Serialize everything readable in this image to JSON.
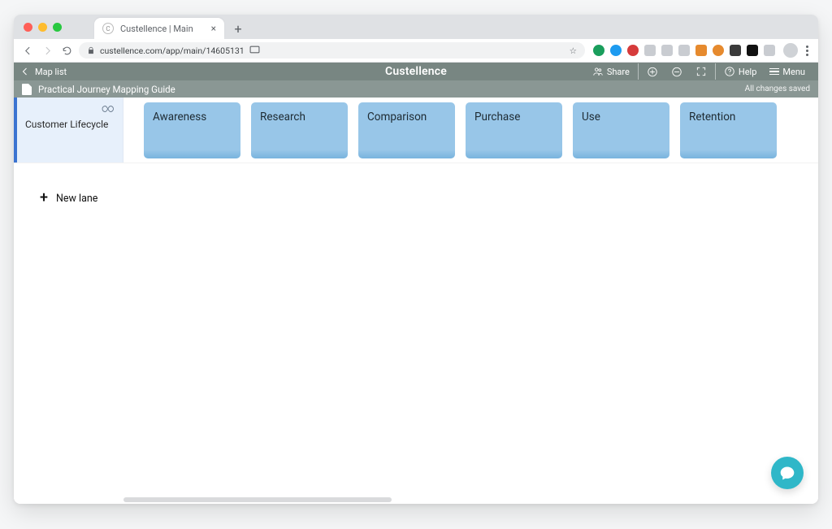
{
  "browser": {
    "tab_title": "Custellence | Main",
    "url": "custellence.com/app/main/14605131",
    "new_tab_label": "+"
  },
  "toolbar": {
    "back_label": "Map list",
    "brand": "Custellence",
    "share_label": "Share",
    "help_label": "Help",
    "menu_label": "Menu"
  },
  "document": {
    "title": "Practical Journey Mapping Guide",
    "status": "All changes saved"
  },
  "lane": {
    "title": "Customer Lifecycle",
    "stages": [
      {
        "label": "Awareness"
      },
      {
        "label": "Research"
      },
      {
        "label": "Comparison"
      },
      {
        "label": "Purchase"
      },
      {
        "label": "Use"
      },
      {
        "label": "Retention"
      }
    ]
  },
  "actions": {
    "new_lane": "New lane"
  }
}
